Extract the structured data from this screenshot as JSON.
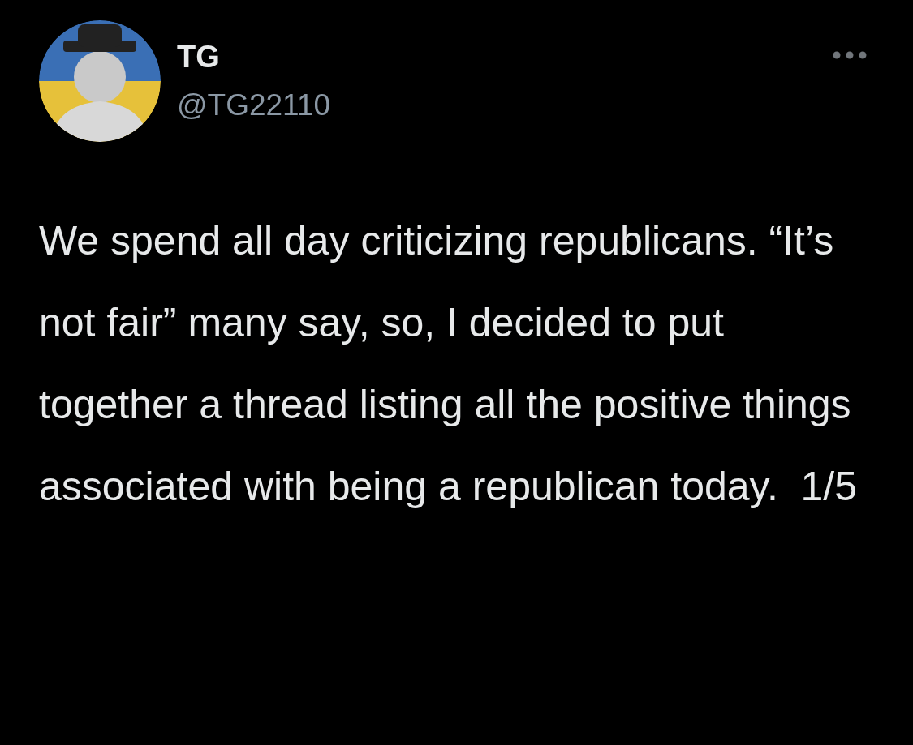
{
  "tweet": {
    "author": {
      "name": "TG",
      "handle": "@TG22110"
    },
    "text": "We spend all day criticizing republicans. “It’s not fair” many say, so, I decided to put together a thread listing all the positive things associated with being a republican today.  1/5"
  }
}
